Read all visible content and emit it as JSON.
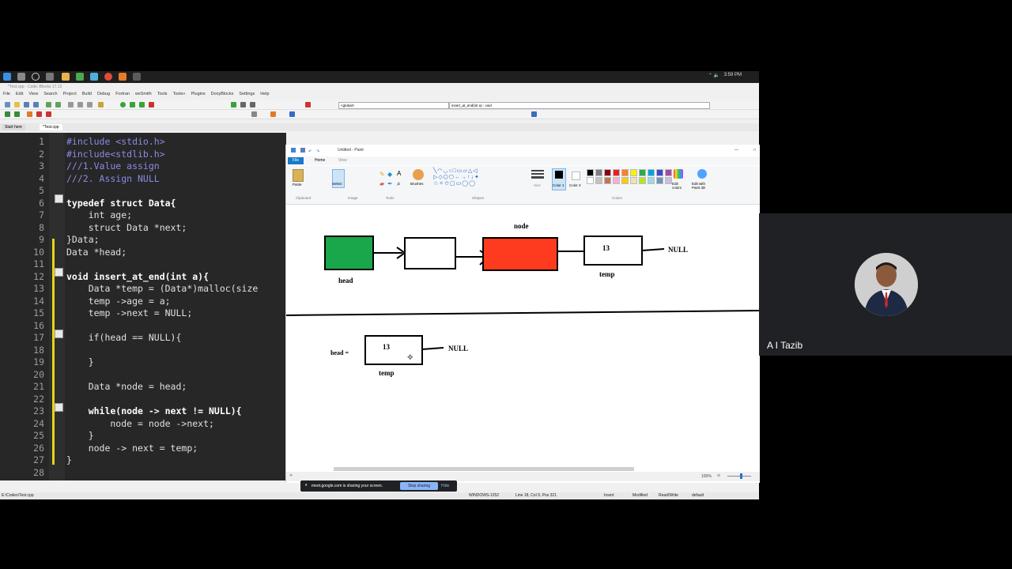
{
  "taskbar": {
    "clock": "3:59 PM"
  },
  "codeblocks": {
    "title": "*Test.cpp - Code::Blocks 17.12",
    "menu": [
      "File",
      "Edit",
      "View",
      "Search",
      "Project",
      "Build",
      "Debug",
      "Fortran",
      "wxSmith",
      "Tools",
      "Tools+",
      "Plugins",
      "DoxyBlocks",
      "Settings",
      "Help"
    ],
    "scope": "<global>",
    "function": "insert_at_end(int a) : void",
    "tabs": [
      "Start here",
      "*Test.cpp"
    ],
    "code_lines": [
      {
        "n": "1",
        "t": "#include <stdio.h>",
        "c": "comment"
      },
      {
        "n": "2",
        "t": "#include<stdlib.h>",
        "c": "comment"
      },
      {
        "n": "3",
        "t": "///1.Value assign",
        "c": "comment"
      },
      {
        "n": "4",
        "t": "///2. Assign NULL",
        "c": "comment"
      },
      {
        "n": "5",
        "t": "",
        "c": "code"
      },
      {
        "n": "6",
        "t": "typedef struct Data{",
        "c": "keyword"
      },
      {
        "n": "7",
        "t": "    int age;",
        "c": "code"
      },
      {
        "n": "8",
        "t": "    struct Data *next;",
        "c": "code"
      },
      {
        "n": "9",
        "t": "}Data;",
        "c": "code"
      },
      {
        "n": "10",
        "t": "Data *head;",
        "c": "code"
      },
      {
        "n": "11",
        "t": "",
        "c": "code"
      },
      {
        "n": "12",
        "t": "void insert_at_end(int a){",
        "c": "keyword"
      },
      {
        "n": "13",
        "t": "    Data *temp = (Data*)malloc(size",
        "c": "code"
      },
      {
        "n": "14",
        "t": "    temp ->age = a;",
        "c": "code"
      },
      {
        "n": "15",
        "t": "    temp ->next = NULL;",
        "c": "code"
      },
      {
        "n": "16",
        "t": "",
        "c": "code"
      },
      {
        "n": "17",
        "t": "    if(head == NULL){",
        "c": "code"
      },
      {
        "n": "18",
        "t": "",
        "c": "code"
      },
      {
        "n": "19",
        "t": "    }",
        "c": "code"
      },
      {
        "n": "20",
        "t": "",
        "c": "code"
      },
      {
        "n": "21",
        "t": "    Data *node = head;",
        "c": "code"
      },
      {
        "n": "22",
        "t": "",
        "c": "code"
      },
      {
        "n": "23",
        "t": "    while(node -> next != NULL){",
        "c": "keyword"
      },
      {
        "n": "24",
        "t": "        node = node ->next;",
        "c": "code"
      },
      {
        "n": "25",
        "t": "    }",
        "c": "code"
      },
      {
        "n": "26",
        "t": "    node -> next = temp;",
        "c": "code"
      },
      {
        "n": "27",
        "t": "}",
        "c": "code"
      },
      {
        "n": "28",
        "t": "",
        "c": "code"
      }
    ],
    "status": {
      "path": "E:\\Codes\\Test.cpp",
      "encoding": "WINDOWS-1252",
      "position": "Line 18, Col 9, Pos 321",
      "mode": "Insert",
      "modified": "Modified",
      "access": "Read/Write",
      "lang": "default"
    }
  },
  "paint": {
    "title": "Untitled - Paint",
    "tabs": {
      "file": "File",
      "home": "Home",
      "view": "View"
    },
    "groups": {
      "clipboard": "Clipboard",
      "image": "Image",
      "tools": "Tools",
      "shapes": "Shapes",
      "colors": "Colors"
    },
    "buttons": {
      "paste": "Paste",
      "select": "Select",
      "brushes": "Brushes",
      "size": "Size",
      "color1": "Color 1",
      "color2": "Color 2",
      "edit_colors": "Edit colors",
      "edit_paint3d": "Edit with Paint 3D"
    },
    "palette": [
      "#000000",
      "#7f7f7f",
      "#880015",
      "#ed1c24",
      "#ff7f27",
      "#fff200",
      "#22b14c",
      "#00a2e8",
      "#3f48cc",
      "#a349a4",
      "#ffffff",
      "#c3c3c3",
      "#b97a57",
      "#ffaec9",
      "#ffc90e",
      "#efe4b0",
      "#b5e61d",
      "#99d9ea",
      "#7092be",
      "#c8bfe7"
    ],
    "zoom": "100%",
    "drawing": {
      "label_node": "node",
      "label_head": "head",
      "label_temp_top": "temp",
      "value_top": "13",
      "null_top": "NULL",
      "label_head_eq": "head =",
      "value_bottom": "13",
      "null_bottom": "NULL",
      "label_temp_bottom": "temp",
      "head_color": "#1aa64a",
      "node_color": "#ff3b1f"
    }
  },
  "share_bar": {
    "message": "meet.google.com is sharing your screen.",
    "stop": "Stop sharing",
    "hide": "Hide"
  },
  "participant": {
    "name": "A I Tazib"
  }
}
